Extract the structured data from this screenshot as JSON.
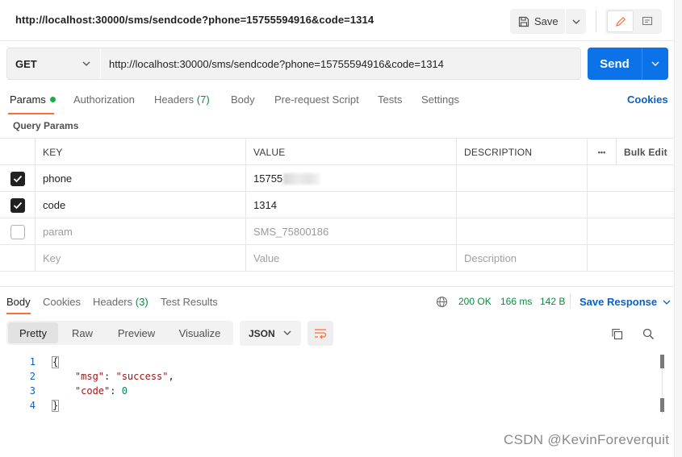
{
  "title_url": "http://localhost:30000/sms/sendcode?phone=15755594916&code=1314",
  "toolbar": {
    "save_label": "Save"
  },
  "request": {
    "method": "GET",
    "url": "http://localhost:30000/sms/sendcode?phone=15755594916&code=1314",
    "send_label": "Send"
  },
  "req_tabs": [
    {
      "label": "Params",
      "active": true
    },
    {
      "label": "Authorization"
    },
    {
      "label": "Headers",
      "count": "(7)"
    },
    {
      "label": "Body"
    },
    {
      "label": "Pre-request Script"
    },
    {
      "label": "Tests"
    },
    {
      "label": "Settings"
    }
  ],
  "cookies_link": "Cookies",
  "section_label": "Query Params",
  "params_table": {
    "headers": [
      "KEY",
      "VALUE",
      "DESCRIPTION"
    ],
    "more_icon": "•••",
    "bulk_edit": "Bulk Edit",
    "rows": [
      {
        "checked": true,
        "key": "phone",
        "value": "15755",
        "description": ""
      },
      {
        "checked": true,
        "key": "code",
        "value": "1314",
        "description": ""
      },
      {
        "checked": false,
        "key": "param",
        "value": "SMS_75800186",
        "description": ""
      }
    ],
    "new_row": {
      "key": "Key",
      "value": "Value",
      "description": "Description"
    }
  },
  "resp_tabs": [
    {
      "label": "Body",
      "active": true
    },
    {
      "label": "Cookies"
    },
    {
      "label": "Headers",
      "count": "(3)"
    },
    {
      "label": "Test Results"
    }
  ],
  "resp_status": {
    "code": "200 OK",
    "time": "166 ms",
    "size": "142 B"
  },
  "save_response": "Save Response",
  "view_modes": [
    "Pretty",
    "Raw",
    "Preview",
    "Visualize"
  ],
  "format": "JSON",
  "code_lines": [
    {
      "num": "1",
      "text": "{"
    },
    {
      "num": "2",
      "key": "\"msg\"",
      "val": "\"success\"",
      "tail": ","
    },
    {
      "num": "3",
      "key": "\"code\"",
      "val": "0",
      "tail": ""
    },
    {
      "num": "4",
      "text": "}"
    }
  ],
  "watermark": "CSDN @KevinForeverquit",
  "icons": {
    "save": "floppy-disk-icon",
    "edit": "pencil-icon",
    "comment": "comment-icon",
    "globe": "globe-icon",
    "copy": "copy-icon",
    "search": "search-icon",
    "wrap": "wrap-lines-icon"
  },
  "colors": {
    "accent": "#ff6c37",
    "primary": "#0b72e7",
    "success": "#0a8a3e",
    "link": "#0b5fc5"
  }
}
